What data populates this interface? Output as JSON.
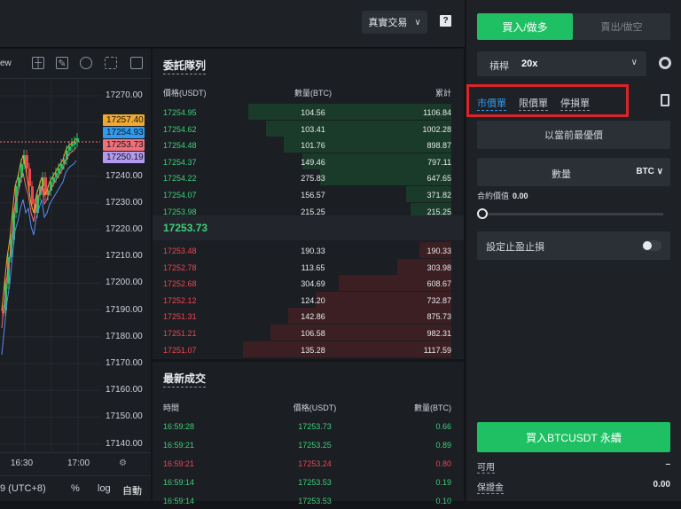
{
  "header": {
    "account_mode": "真實交易",
    "help": "?"
  },
  "chart": {
    "toolbar_text": "ew",
    "y_ticks": [
      "17270.00",
      "17260.00",
      "17250.00",
      "17240.00",
      "17230.00",
      "17220.00",
      "17210.00",
      "17200.00",
      "17190.00",
      "17180.00",
      "17170.00",
      "17160.00",
      "17150.00",
      "17140.00"
    ],
    "price_tags": [
      {
        "label": "17257.40",
        "color": "#f0a830"
      },
      {
        "label": "17254.93",
        "color": "#2f9bf0"
      },
      {
        "label": "17253.73",
        "color": "#f0707a"
      },
      {
        "label": "17250.19",
        "color": "#b39cf0"
      }
    ],
    "x_ticks": [
      "16:30",
      "17:00"
    ],
    "timezone": "9 (UTC+8)",
    "percent": "%",
    "log": "log",
    "auto": "自動",
    "colors": {
      "up": "#1fc063",
      "down": "#f0454e"
    }
  },
  "orderbook": {
    "title": "委託隊列",
    "headers": {
      "price": "價格(USDT)",
      "qty": "數量(BTC)",
      "total": "累計"
    },
    "bids": [
      {
        "price": "17254.95",
        "qty": "104.56",
        "total": "1106.84",
        "depth": 0.9
      },
      {
        "price": "17254.62",
        "qty": "103.41",
        "total": "1002.28",
        "depth": 0.82
      },
      {
        "price": "17254.48",
        "qty": "101.76",
        "total": "898.87",
        "depth": 0.74
      },
      {
        "price": "17254.37",
        "qty": "149.46",
        "total": "797.11",
        "depth": 0.66
      },
      {
        "price": "17254.22",
        "qty": "275.83",
        "total": "647.65",
        "depth": 0.58
      },
      {
        "price": "17254.07",
        "qty": "156.57",
        "total": "371.82",
        "depth": 0.2
      },
      {
        "price": "17253.98",
        "qty": "215.25",
        "total": "215.25",
        "depth": 0.18
      }
    ],
    "mid_price": "17253.73",
    "asks": [
      {
        "price": "17253.48",
        "qty": "190.33",
        "total": "190.33",
        "depth": 0.14
      },
      {
        "price": "17252.78",
        "qty": "113.65",
        "total": "303.98",
        "depth": 0.24
      },
      {
        "price": "17252.68",
        "qty": "304.69",
        "total": "608.67",
        "depth": 0.5
      },
      {
        "price": "17252.12",
        "qty": "124.20",
        "total": "732.87",
        "depth": 0.6
      },
      {
        "price": "17251.31",
        "qty": "142.86",
        "total": "875.73",
        "depth": 0.72
      },
      {
        "price": "17251.21",
        "qty": "106.58",
        "total": "982.31",
        "depth": 0.8
      },
      {
        "price": "17251.07",
        "qty": "135.28",
        "total": "1117.59",
        "depth": 0.92
      }
    ]
  },
  "trades": {
    "title": "最新成交",
    "headers": {
      "time": "時間",
      "price": "價格(USDT)",
      "qty": "數量(BTC)"
    },
    "rows": [
      {
        "time": "16:59:28",
        "price": "17253.73",
        "qty": "0.66",
        "side": "buy"
      },
      {
        "time": "16:59:21",
        "price": "17253.25",
        "qty": "0.89",
        "side": "buy"
      },
      {
        "time": "16:59:21",
        "price": "17253.24",
        "qty": "0.80",
        "side": "sell"
      },
      {
        "time": "16:59:14",
        "price": "17253.53",
        "qty": "0.19",
        "side": "buy"
      },
      {
        "time": "16:59:14",
        "price": "17253.53",
        "qty": "0.10",
        "side": "buy"
      }
    ]
  },
  "order_form": {
    "buy_tab": "買入/做多",
    "sell_tab": "賣出/做空",
    "leverage_label": "槓桿",
    "leverage_value": "20x",
    "order_types": [
      "市價單",
      "限價單",
      "停損單"
    ],
    "price_placeholder": "以當前最優價",
    "qty_label": "數量",
    "qty_unit": "BTC",
    "contract_value_label": "合約價值",
    "contract_value": "0.00",
    "tpsl_label": "設定止盈止損",
    "buy_button": "買入BTCUSDT 永續",
    "available_label": "可用",
    "available_value": "–",
    "margin_label": "保證金",
    "margin_value": "0.00"
  }
}
